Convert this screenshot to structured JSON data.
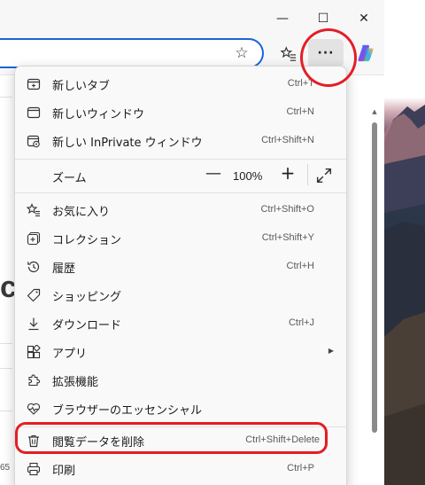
{
  "window": {
    "minimize_glyph": "—",
    "maximize_glyph": "☐",
    "close_glyph": "✕"
  },
  "toolbar": {
    "more_glyph": "···",
    "favorite_glyph": "☆"
  },
  "page": {
    "fragment_text": "c",
    "page_number": "65"
  },
  "menu": {
    "items": [
      {
        "label": "新しいタブ",
        "shortcut": "Ctrl+T",
        "icon": "new-tab-icon"
      },
      {
        "label": "新しいウィンドウ",
        "shortcut": "Ctrl+N",
        "icon": "new-window-icon"
      },
      {
        "label": "新しい InPrivate ウィンドウ",
        "shortcut": "Ctrl+Shift+N",
        "icon": "inprivate-icon"
      },
      {
        "label": "ズーム",
        "shortcut": "",
        "icon": ""
      },
      {
        "label": "お気に入り",
        "shortcut": "Ctrl+Shift+O",
        "icon": "favorites-icon"
      },
      {
        "label": "コレクション",
        "shortcut": "Ctrl+Shift+Y",
        "icon": "collections-icon"
      },
      {
        "label": "履歴",
        "shortcut": "Ctrl+H",
        "icon": "history-icon"
      },
      {
        "label": "ショッピング",
        "shortcut": "",
        "icon": "shopping-tag-icon"
      },
      {
        "label": "ダウンロード",
        "shortcut": "Ctrl+J",
        "icon": "download-icon"
      },
      {
        "label": "アプリ",
        "shortcut": "",
        "icon": "apps-icon",
        "submenu_glyph": "▶"
      },
      {
        "label": "拡張機能",
        "shortcut": "",
        "icon": "extensions-icon"
      },
      {
        "label": "ブラウザーのエッセンシャル",
        "shortcut": "",
        "icon": "essentials-heart-icon"
      },
      {
        "label": "閲覧データを削除",
        "shortcut": "Ctrl+Shift+Delete",
        "icon": "trash-icon"
      },
      {
        "label": "印刷",
        "shortcut": "Ctrl+P",
        "icon": "print-icon"
      }
    ],
    "zoom": {
      "minus": "—",
      "value": "100%",
      "plus": "+"
    }
  },
  "colors": {
    "annotation": "#e21f26",
    "address_border": "#1a65d6",
    "menu_bg": "#f9f9f9"
  }
}
